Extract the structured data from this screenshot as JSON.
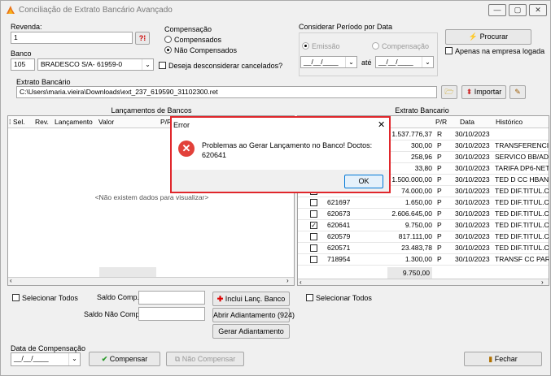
{
  "window": {
    "title": "Conciliação de Extrato Bancário Avançado",
    "controls": [
      "—",
      "▢",
      "✕"
    ]
  },
  "revenda": {
    "label": "Revenda:",
    "value": "1"
  },
  "compensacao": {
    "label": "Compensação",
    "options": [
      {
        "label": "Compensados",
        "selected": false
      },
      {
        "label": "Não Compensados",
        "selected": true
      }
    ]
  },
  "banco": {
    "label": "Banco",
    "code": "105",
    "name": "BRADESCO S/A- 61959-0"
  },
  "desconsiderar": {
    "label": "Deseja desconsiderar cancelados?",
    "checked": false
  },
  "periodo": {
    "label": "Considerar Período por Data",
    "options": [
      {
        "label": "Emissão",
        "selected": true
      },
      {
        "label": "Compensação",
        "selected": false
      }
    ],
    "from": "__/__/____",
    "ate": "até",
    "to": "__/__/____"
  },
  "procurar": {
    "label": "Procurar"
  },
  "apenas": {
    "label": "Apenas na empresa logada",
    "checked": false
  },
  "extrato": {
    "label": "Extrato Bancário",
    "path": "C:\\Users\\maria.vieira\\Downloads\\ext_237_619590_31102300.ret",
    "importar": "Importar"
  },
  "lancamentos": {
    "title": "Lançamentos de Bancos",
    "columns": [
      "Sel.",
      "Rev.",
      "Lançamento",
      "Valor",
      "P/R"
    ],
    "empty": "<Não existem dados para visualizar>",
    "select_all": "Selecionar Todos"
  },
  "saldo": {
    "comp_label": "Saldo Comp.:",
    "nao_comp_label": "Saldo Não Comp.:"
  },
  "actions": {
    "inclui": "Inclui Lanç. Banco",
    "abrir": "Abrir Adiantamento (924)",
    "gerar": "Gerar Adiantamento"
  },
  "extrato_grid": {
    "title": "Extrato Bancario",
    "columns": [
      "P/R",
      "Data",
      "Histórico"
    ],
    "rows": [
      {
        "checked": false,
        "doc": "",
        "valor": "1.537.776,37",
        "pr": "R",
        "data": "30/10/2023",
        "hist": ""
      },
      {
        "checked": false,
        "doc": "",
        "valor": "300,00",
        "pr": "P",
        "data": "30/10/2023",
        "hist": "TRANSFERENCIA"
      },
      {
        "checked": false,
        "doc": "",
        "valor": "258,96",
        "pr": "P",
        "data": "30/10/2023",
        "hist": "SERVICO BB/ADV"
      },
      {
        "checked": false,
        "doc": "",
        "valor": "33,80",
        "pr": "P",
        "data": "30/10/2023",
        "hist": "TARIFA DP6-NET"
      },
      {
        "checked": false,
        "doc": "",
        "valor": "1.500.000,00",
        "pr": "P",
        "data": "30/10/2023",
        "hist": "TED D CC HBANK"
      },
      {
        "checked": false,
        "doc": "",
        "valor": "74.000,00",
        "pr": "P",
        "data": "30/10/2023",
        "hist": "TED DIF.TITUL.C"
      },
      {
        "checked": false,
        "doc": "621697",
        "valor": "1.650,00",
        "pr": "P",
        "data": "30/10/2023",
        "hist": "TED DIF.TITUL.C"
      },
      {
        "checked": false,
        "doc": "620673",
        "valor": "2.606.645,00",
        "pr": "P",
        "data": "30/10/2023",
        "hist": "TED DIF.TITUL.C"
      },
      {
        "checked": true,
        "doc": "620641",
        "valor": "9.750,00",
        "pr": "P",
        "data": "30/10/2023",
        "hist": "TED DIF.TITUL.C"
      },
      {
        "checked": false,
        "doc": "620579",
        "valor": "817.111,00",
        "pr": "P",
        "data": "30/10/2023",
        "hist": "TED DIF.TITUL.C"
      },
      {
        "checked": false,
        "doc": "620571",
        "valor": "23.483,78",
        "pr": "P",
        "data": "30/10/2023",
        "hist": "TED DIF.TITUL.C"
      },
      {
        "checked": false,
        "doc": "718954",
        "valor": "1.300,00",
        "pr": "P",
        "data": "30/10/2023",
        "hist": "TRANSF CC PARA"
      }
    ],
    "total": "9.750,00",
    "select_all": "Selecionar Todos"
  },
  "data_comp": {
    "label": "Data de Compensação",
    "value": "__/__/____"
  },
  "compensar": "Compensar",
  "nao_compensar": "Não Compensar",
  "fechar": "Fechar",
  "dialog": {
    "title": "Error",
    "message": "Problemas ao Gerar Lançamento no Banco! Doctos: 620641",
    "ok": "OK",
    "close": "✕"
  },
  "colors": {
    "error_border": "#e0262b",
    "error_icon": "#e2413a",
    "accent": "#0078d7"
  }
}
